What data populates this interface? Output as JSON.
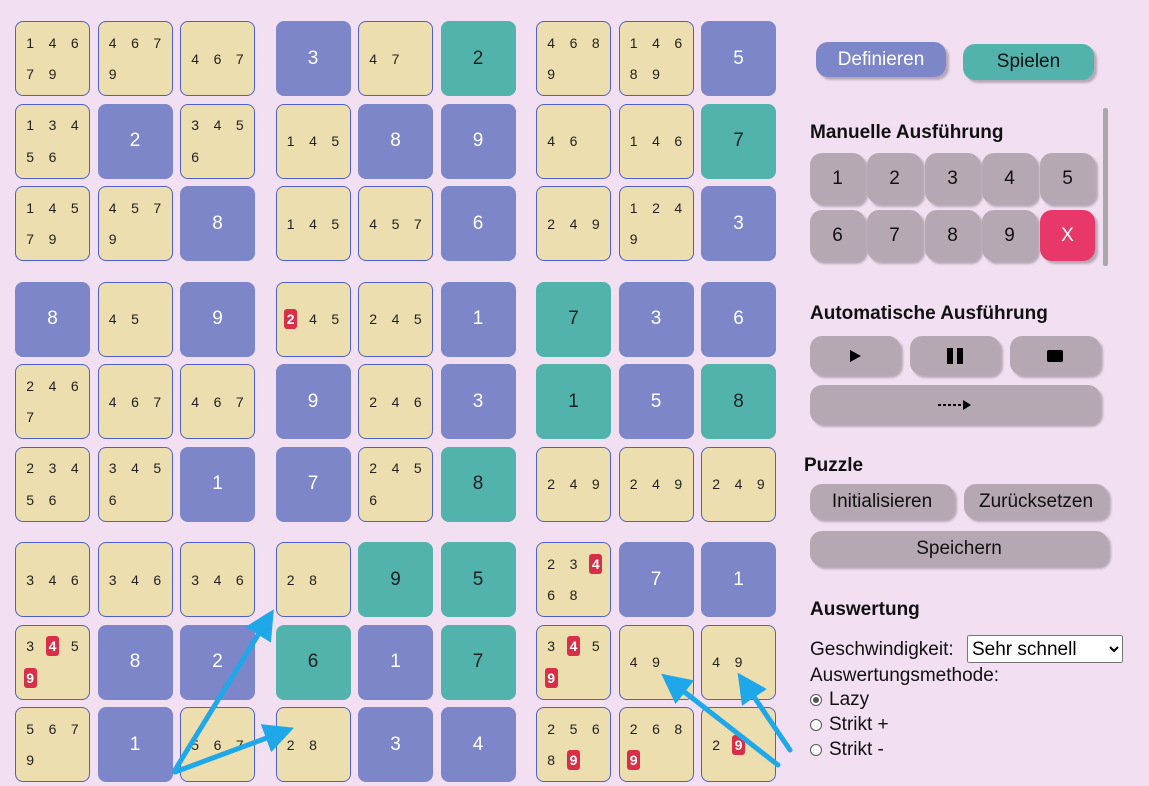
{
  "board": {
    "rows": [
      [
        {
          "t": "c",
          "c": [
            "1",
            "4",
            "6",
            "7",
            "9"
          ]
        },
        {
          "t": "c",
          "c": [
            "4",
            "6",
            "7",
            "9"
          ]
        },
        {
          "t": "c",
          "c": [
            "4",
            "6",
            "7"
          ]
        },
        {
          "t": "g",
          "v": "3"
        },
        {
          "t": "c",
          "c": [
            "4",
            "7"
          ]
        },
        {
          "t": "s",
          "v": "2"
        },
        {
          "t": "c",
          "c": [
            "4",
            "6",
            "8",
            "9"
          ]
        },
        {
          "t": "c",
          "c": [
            "1",
            "4",
            "6",
            "8",
            "9"
          ]
        },
        {
          "t": "g",
          "v": "5"
        }
      ],
      [
        {
          "t": "c",
          "c": [
            "1",
            "3",
            "4",
            "5",
            "6"
          ]
        },
        {
          "t": "g",
          "v": "2"
        },
        {
          "t": "c",
          "c": [
            "3",
            "4",
            "5",
            "6"
          ]
        },
        {
          "t": "c",
          "c": [
            "1",
            "4",
            "5"
          ]
        },
        {
          "t": "g",
          "v": "8"
        },
        {
          "t": "g",
          "v": "9"
        },
        {
          "t": "c",
          "c": [
            "4",
            "6"
          ]
        },
        {
          "t": "c",
          "c": [
            "1",
            "4",
            "6"
          ]
        },
        {
          "t": "s",
          "v": "7"
        }
      ],
      [
        {
          "t": "c",
          "c": [
            "1",
            "4",
            "5",
            "7",
            "9"
          ]
        },
        {
          "t": "c",
          "c": [
            "4",
            "5",
            "7",
            "9"
          ]
        },
        {
          "t": "g",
          "v": "8"
        },
        {
          "t": "c",
          "c": [
            "1",
            "4",
            "5"
          ]
        },
        {
          "t": "c",
          "c": [
            "4",
            "5",
            "7"
          ]
        },
        {
          "t": "g",
          "v": "6"
        },
        {
          "t": "c",
          "c": [
            "2",
            "4",
            "9"
          ]
        },
        {
          "t": "c",
          "c": [
            "1",
            "2",
            "4",
            "9"
          ]
        },
        {
          "t": "g",
          "v": "3"
        }
      ],
      [
        {
          "t": "g",
          "v": "8"
        },
        {
          "t": "c",
          "c": [
            "4",
            "5"
          ]
        },
        {
          "t": "g",
          "v": "9"
        },
        {
          "t": "c",
          "c": [
            "2",
            "4",
            "5"
          ],
          "hl": [
            "2"
          ]
        },
        {
          "t": "c",
          "c": [
            "2",
            "4",
            "5"
          ]
        },
        {
          "t": "g",
          "v": "1"
        },
        {
          "t": "s",
          "v": "7"
        },
        {
          "t": "g",
          "v": "3"
        },
        {
          "t": "g",
          "v": "6"
        }
      ],
      [
        {
          "t": "c",
          "c": [
            "2",
            "4",
            "6",
            "7"
          ]
        },
        {
          "t": "c",
          "c": [
            "4",
            "6",
            "7"
          ]
        },
        {
          "t": "c",
          "c": [
            "4",
            "6",
            "7"
          ]
        },
        {
          "t": "g",
          "v": "9"
        },
        {
          "t": "c",
          "c": [
            "2",
            "4",
            "6"
          ]
        },
        {
          "t": "g",
          "v": "3"
        },
        {
          "t": "s",
          "v": "1"
        },
        {
          "t": "g",
          "v": "5"
        },
        {
          "t": "s",
          "v": "8"
        }
      ],
      [
        {
          "t": "c",
          "c": [
            "2",
            "3",
            "4",
            "5",
            "6"
          ]
        },
        {
          "t": "c",
          "c": [
            "3",
            "4",
            "5",
            "6"
          ]
        },
        {
          "t": "g",
          "v": "1"
        },
        {
          "t": "g",
          "v": "7"
        },
        {
          "t": "c",
          "c": [
            "2",
            "4",
            "5",
            "6"
          ]
        },
        {
          "t": "s",
          "v": "8"
        },
        {
          "t": "c",
          "c": [
            "2",
            "4",
            "9"
          ]
        },
        {
          "t": "c",
          "c": [
            "2",
            "4",
            "9"
          ]
        },
        {
          "t": "c",
          "c": [
            "2",
            "4",
            "9"
          ]
        }
      ],
      [
        {
          "t": "c",
          "c": [
            "3",
            "4",
            "6"
          ]
        },
        {
          "t": "c",
          "c": [
            "3",
            "4",
            "6"
          ]
        },
        {
          "t": "c",
          "c": [
            "3",
            "4",
            "6"
          ]
        },
        {
          "t": "c",
          "c": [
            "2",
            "8"
          ]
        },
        {
          "t": "s",
          "v": "9"
        },
        {
          "t": "s",
          "v": "5"
        },
        {
          "t": "c",
          "c": [
            "2",
            "3",
            "4",
            "6",
            "8"
          ],
          "hl": [
            "4"
          ]
        },
        {
          "t": "g",
          "v": "7"
        },
        {
          "t": "g",
          "v": "1"
        }
      ],
      [
        {
          "t": "c",
          "c": [
            "3",
            "4",
            "5",
            "9"
          ],
          "hl": [
            "4",
            "9"
          ]
        },
        {
          "t": "g",
          "v": "8"
        },
        {
          "t": "g",
          "v": "2"
        },
        {
          "t": "s",
          "v": "6"
        },
        {
          "t": "g",
          "v": "1"
        },
        {
          "t": "s",
          "v": "7"
        },
        {
          "t": "c",
          "c": [
            "3",
            "4",
            "5",
            "9"
          ],
          "hl": [
            "4",
            "9"
          ]
        },
        {
          "t": "c",
          "c": [
            "4",
            "9"
          ]
        },
        {
          "t": "c",
          "c": [
            "4",
            "9"
          ]
        }
      ],
      [
        {
          "t": "c",
          "c": [
            "5",
            "6",
            "7",
            "9"
          ]
        },
        {
          "t": "g",
          "v": "1"
        },
        {
          "t": "c",
          "c": [
            "5",
            "6",
            "7"
          ]
        },
        {
          "t": "c",
          "c": [
            "2",
            "8"
          ]
        },
        {
          "t": "g",
          "v": "3"
        },
        {
          "t": "g",
          "v": "4"
        },
        {
          "t": "c",
          "c": [
            "2",
            "5",
            "6",
            "8",
            "9"
          ],
          "hl": [
            "9"
          ]
        },
        {
          "t": "c",
          "c": [
            "2",
            "6",
            "8",
            "9"
          ],
          "hl": [
            "9"
          ]
        },
        {
          "t": "c",
          "c": [
            "2",
            "9"
          ],
          "hl": [
            "9"
          ]
        }
      ]
    ]
  },
  "colors": {
    "background": "#f2e0f2",
    "candidate_cell": "#ecdeae",
    "given_cell": "#7c86c8",
    "solved_cell": "#52b2ac",
    "highlight": "#d82e48",
    "button_gray": "#b5a8b3",
    "arrow": "#1ea8ea"
  },
  "mode": {
    "define_label": "Definieren",
    "play_label": "Spielen"
  },
  "manual": {
    "title": "Manuelle Ausführung",
    "numbers": [
      "1",
      "2",
      "3",
      "4",
      "5",
      "6",
      "7",
      "8",
      "9"
    ],
    "clear_label": "X"
  },
  "auto": {
    "title": "Automatische Ausführung"
  },
  "puzzle": {
    "title": "Puzzle",
    "init_label": "Initialisieren",
    "reset_label": "Zurücksetzen",
    "save_label": "Speichern"
  },
  "evaluation": {
    "title": "Auswertung",
    "speed_label": "Geschwindigkeit:",
    "speed_value": "Sehr schnell",
    "method_label": "Auswertungsmethode:",
    "methods": [
      {
        "label": "Lazy",
        "selected": true
      },
      {
        "label": "Strikt +",
        "selected": false
      },
      {
        "label": "Strikt -",
        "selected": false
      }
    ]
  }
}
